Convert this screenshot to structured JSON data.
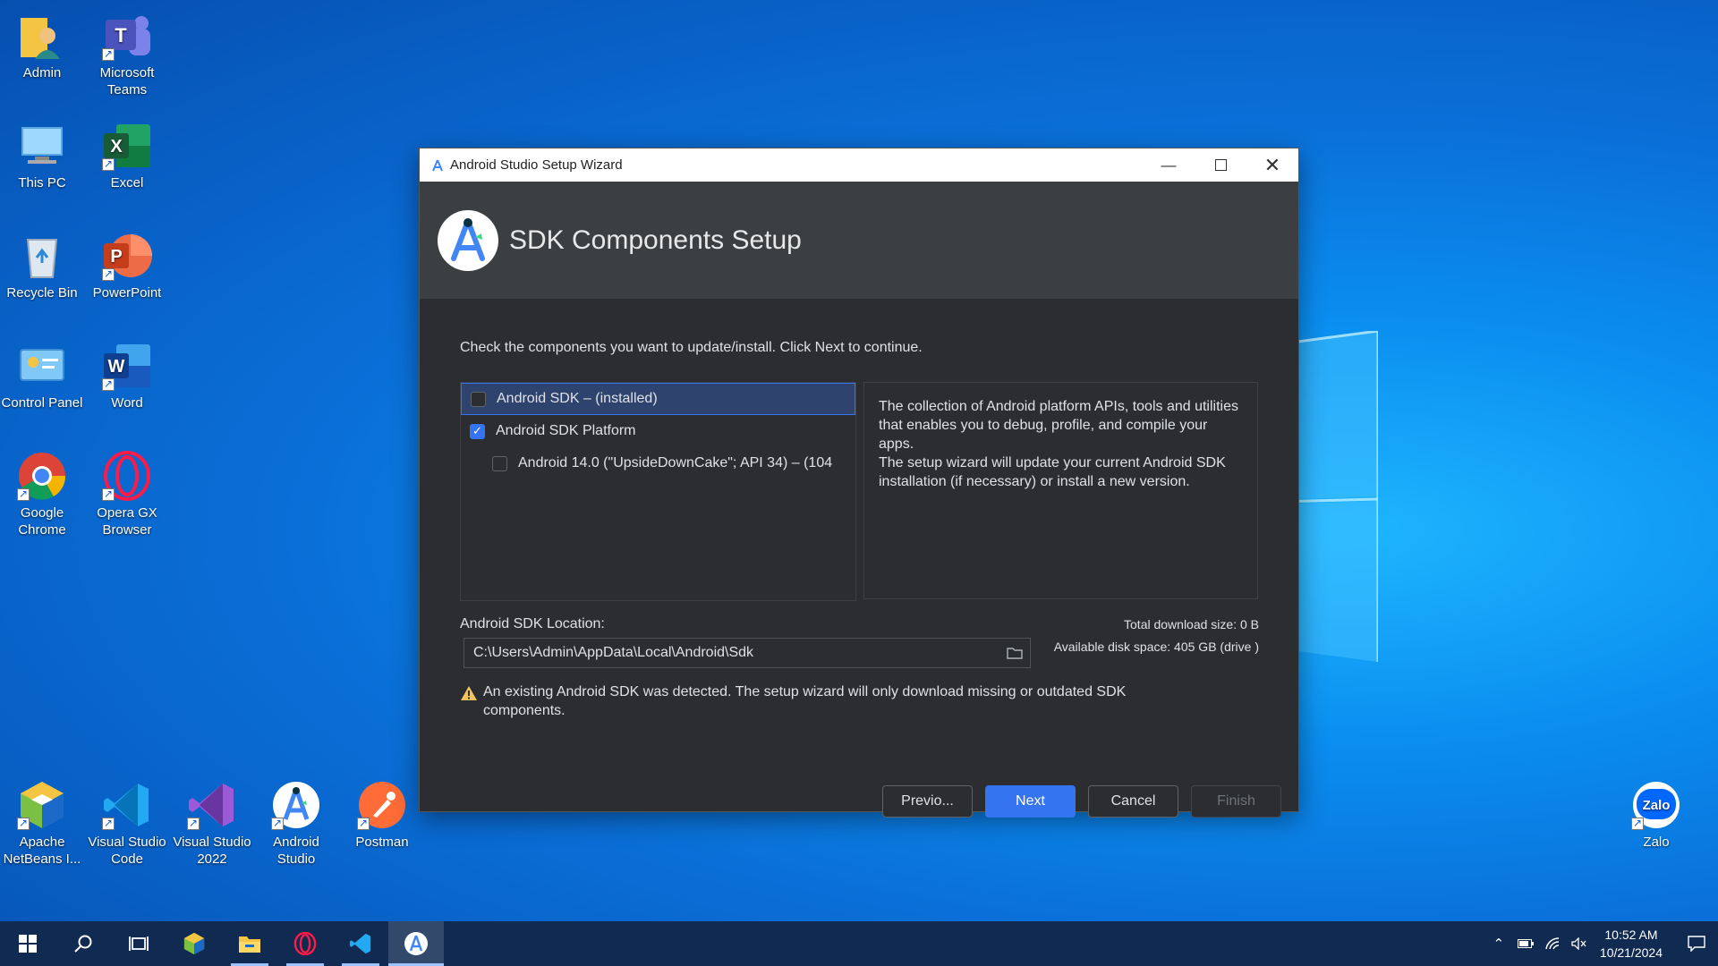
{
  "desktop": {
    "icons": [
      {
        "label": "Admin"
      },
      {
        "label": "Microsoft Teams"
      },
      {
        "label": "This PC"
      },
      {
        "label": "Excel"
      },
      {
        "label": "Recycle Bin"
      },
      {
        "label": "PowerPoint"
      },
      {
        "label": "Control Panel"
      },
      {
        "label": "Word"
      },
      {
        "label": "Google Chrome"
      },
      {
        "label": "Opera GX Browser"
      },
      {
        "label": "Apache NetBeans I..."
      },
      {
        "label": "Visual Studio Code"
      },
      {
        "label": "Visual Studio 2022"
      },
      {
        "label": "Android Studio"
      },
      {
        "label": "Postman"
      },
      {
        "label": "Zalo"
      }
    ]
  },
  "dialog": {
    "title": "Android Studio Setup Wizard",
    "header": "SDK Components Setup",
    "instruction": "Check the components you want to update/install. Click Next to continue.",
    "components": [
      {
        "label": "Android SDK – (installed)",
        "checked": false
      },
      {
        "label": "Android SDK Platform",
        "checked": true
      },
      {
        "label": "Android 14.0 (\"UpsideDownCake\"; API 34) – (104",
        "checked": false
      }
    ],
    "description_1": "The collection of Android platform APIs, tools and utilities that enables you to debug, profile, and compile your apps.",
    "description_2": "The setup wizard will update your current Android SDK installation (if necessary) or install a new version.",
    "location_label": "Android SDK Location:",
    "location_value": "C:\\Users\\Admin\\AppData\\Local\\Android\\Sdk",
    "total_download": "Total download size: 0 B",
    "disk_space": "Available disk space: 405 GB (drive )",
    "warning": "An existing Android SDK was detected. The setup wizard will only download missing or outdated SDK components.",
    "buttons": {
      "previous": "Previo...",
      "next": "Next",
      "cancel": "Cancel",
      "finish": "Finish"
    }
  },
  "taskbar": {
    "time": "10:52 AM",
    "date": "10/21/2024"
  },
  "colors": {
    "accent": "#3574f0",
    "dialog_bg": "#2b2d30",
    "header_bg": "#3c3f41",
    "taskbar_bg": "#102a52"
  }
}
